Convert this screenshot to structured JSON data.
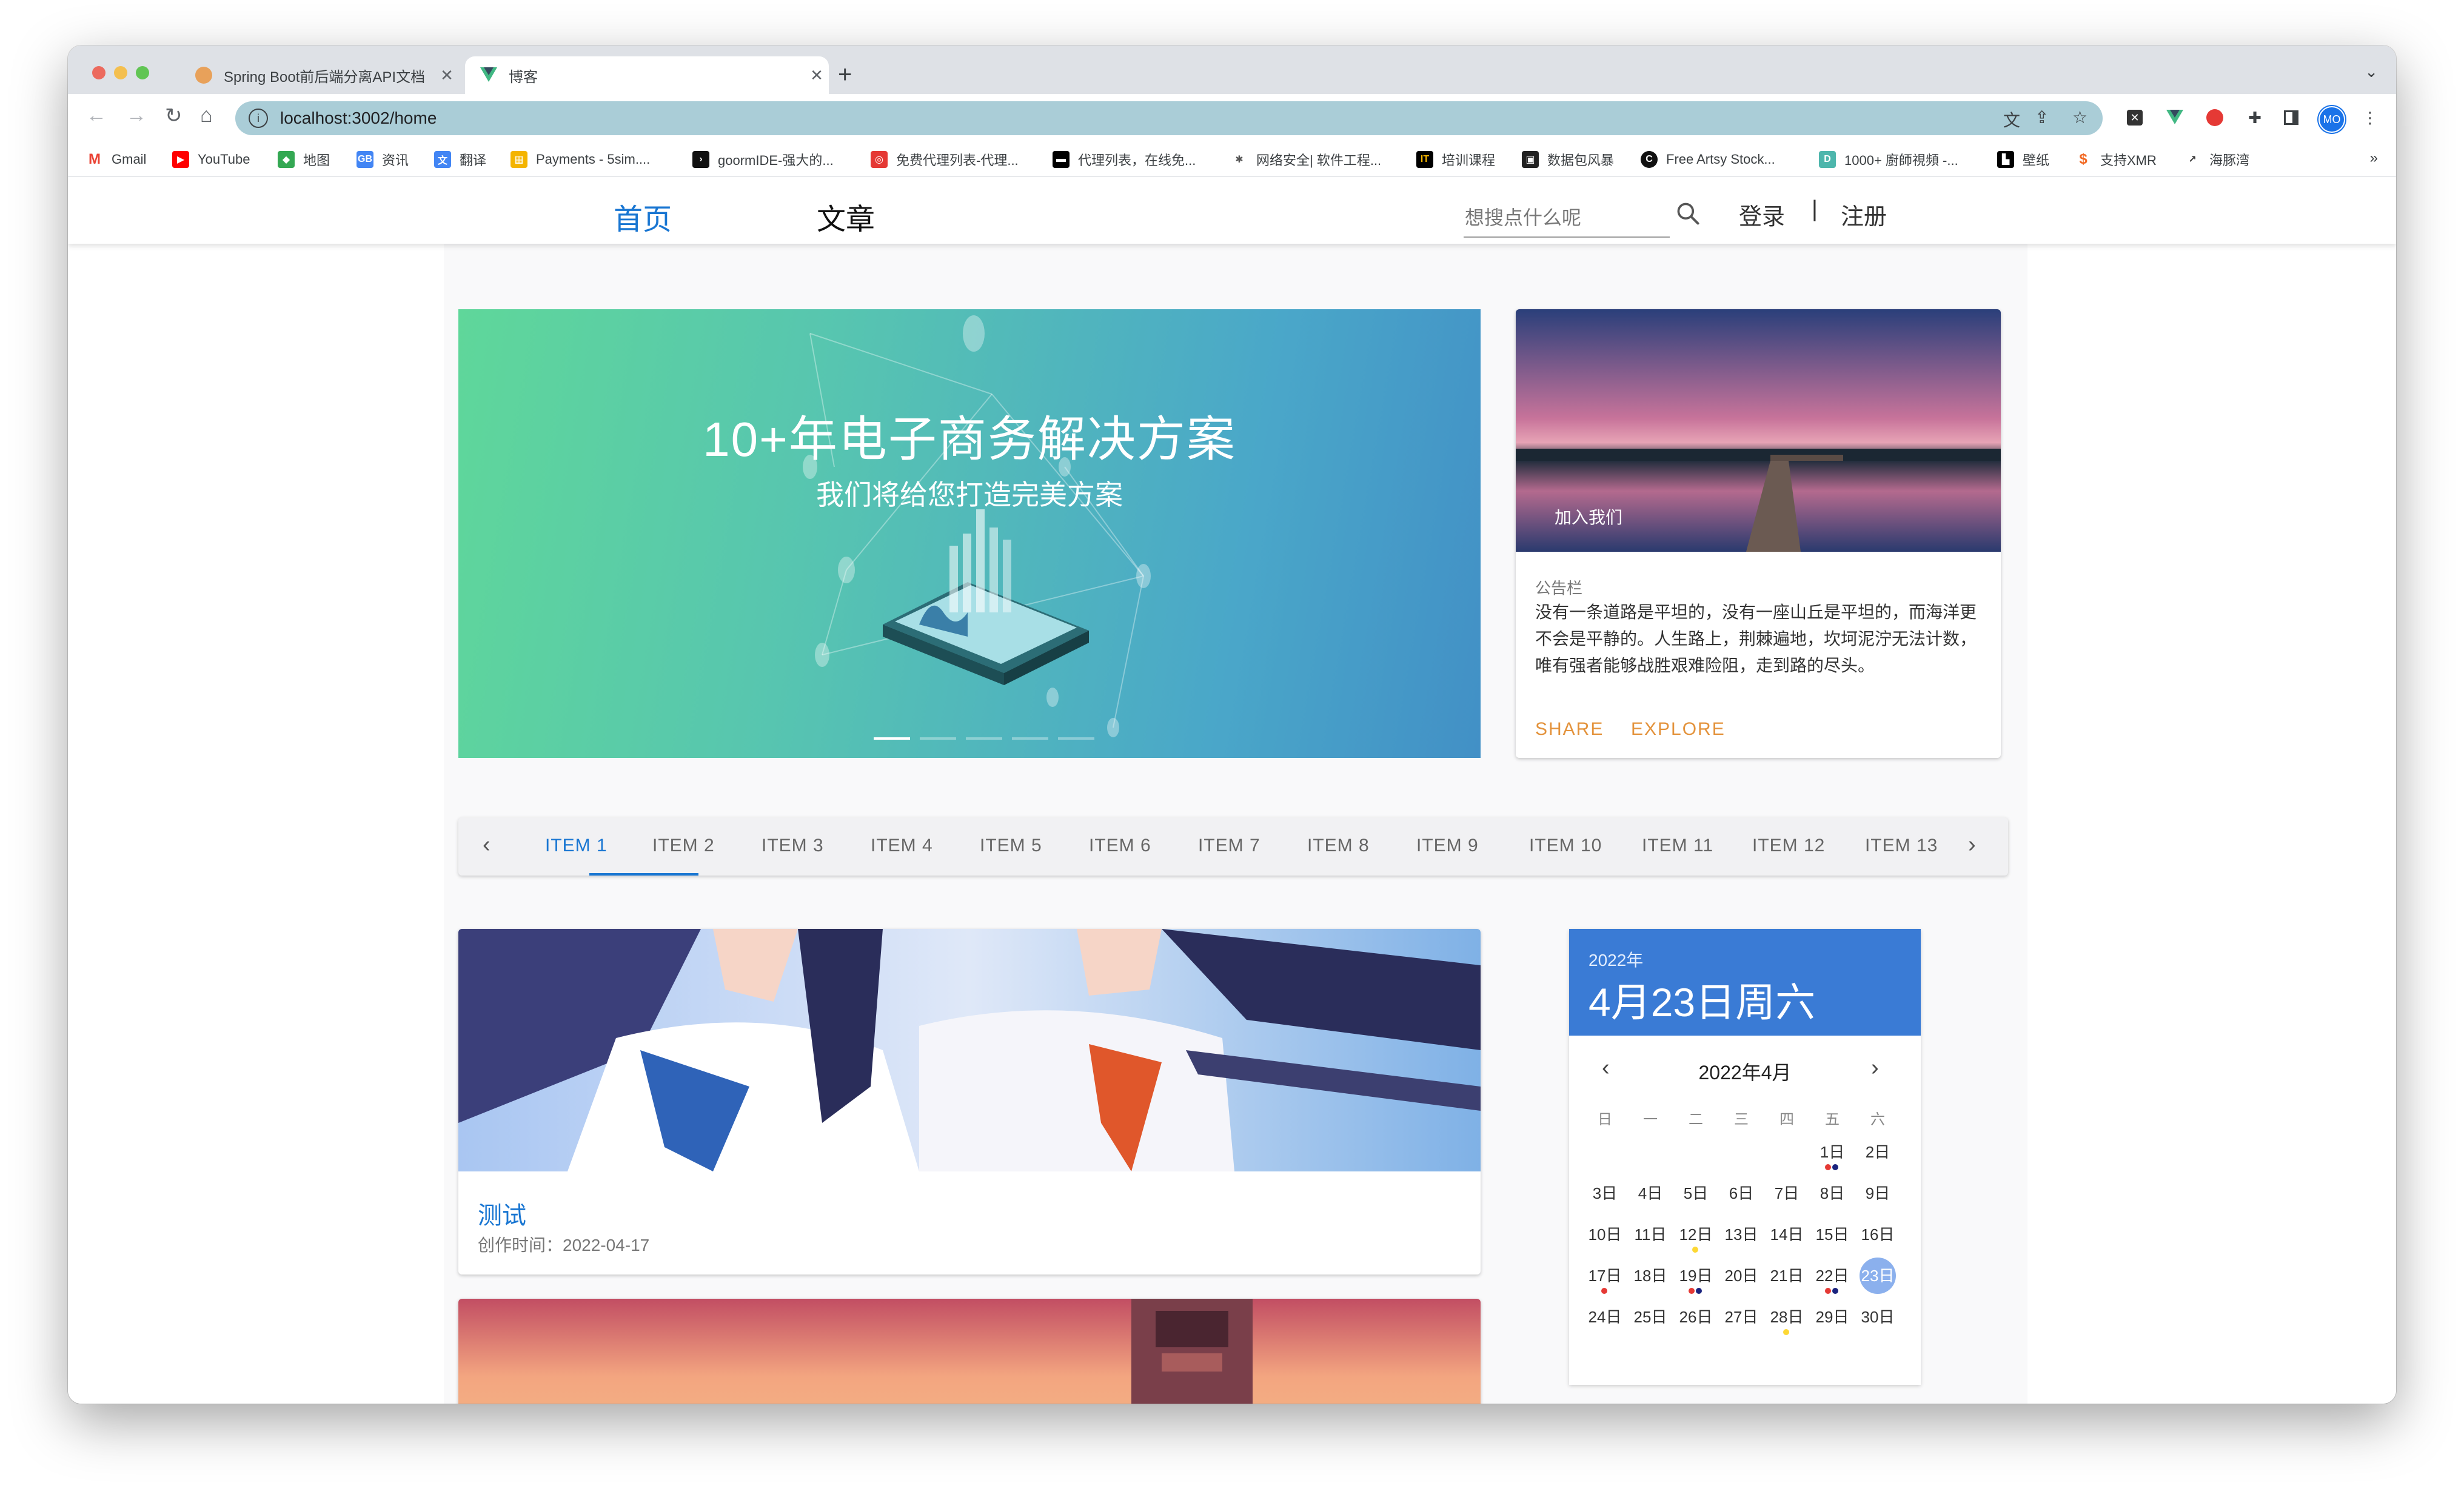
{
  "browser": {
    "tabs": [
      {
        "title": "Spring Boot前后端分离API文档",
        "active": false
      },
      {
        "title": "博客",
        "active": true
      }
    ],
    "url": "localhost:3002/home",
    "profile": "MO",
    "bookmarks": [
      "Gmail",
      "YouTube",
      "地图",
      "资讯",
      "翻译",
      "Payments - 5sim....",
      "goormIDE-强大的...",
      "免费代理列表-代理...",
      "代理列表，在线免...",
      "网络安全| 软件工程...",
      "培训课程",
      "数据包风暴",
      "Free Artsy Stock...",
      "1000+ 廚師視頻 -...",
      "壁纸",
      "支持XMR",
      "海豚湾"
    ]
  },
  "header": {
    "nav_home": "首页",
    "nav_article": "文章",
    "search_placeholder": "想搜点什么呢",
    "login": "登录",
    "separator": "|",
    "register": "注册"
  },
  "carousel": {
    "title": "10+年电子商务解决方案",
    "subtitle": "我们将给您打造完美方案",
    "slide_count": 5,
    "active_slide": 1
  },
  "notice": {
    "image_caption": "加入我们",
    "label": "公告栏",
    "text": "没有一条道路是平坦的，没有一座山丘是平坦的，而海洋更不会是平静的。人生路上，荆棘遍地，坎坷泥泞无法计数，唯有强者能够战胜艰难险阻，走到路的尽头。",
    "share": "SHARE",
    "explore": "EXPLORE"
  },
  "tabs": {
    "items": [
      "ITEM 1",
      "ITEM 2",
      "ITEM 3",
      "ITEM 4",
      "ITEM 5",
      "ITEM 6",
      "ITEM 7",
      "ITEM 8",
      "ITEM 9",
      "ITEM 10",
      "ITEM 11",
      "ITEM 12",
      "ITEM 13"
    ],
    "active": "ITEM 1"
  },
  "posts": [
    {
      "title": "测试",
      "date": "创作时间：2022-04-17"
    }
  ],
  "calendar": {
    "year": "2022年",
    "selected_label": "4月23日周六",
    "month_label": "2022年4月",
    "weekdays": [
      "日",
      "一",
      "二",
      "三",
      "四",
      "五",
      "六"
    ],
    "first_weekday": 5,
    "days": [
      "1日",
      "2日",
      "3日",
      "4日",
      "5日",
      "6日",
      "7日",
      "8日",
      "9日",
      "10日",
      "11日",
      "12日",
      "13日",
      "14日",
      "15日",
      "16日",
      "17日",
      "18日",
      "19日",
      "20日",
      "21日",
      "22日",
      "23日",
      "24日",
      "25日",
      "26日",
      "27日",
      "28日",
      "29日",
      "30日"
    ],
    "selected_day": 23,
    "events": {
      "1": [
        "#e53935",
        "#1a237e"
      ],
      "12": [
        "#fdd835"
      ],
      "17": [
        "#e53935"
      ],
      "19": [
        "#e53935",
        "#1a237e"
      ],
      "22": [
        "#e53935",
        "#1a237e"
      ],
      "28": [
        "#fdd835"
      ]
    }
  },
  "colors": {
    "accent": "#1976d2",
    "card_action": "#e3923b",
    "calendar_header": "#3a7bd5",
    "omnibox": "#aacdd7"
  }
}
